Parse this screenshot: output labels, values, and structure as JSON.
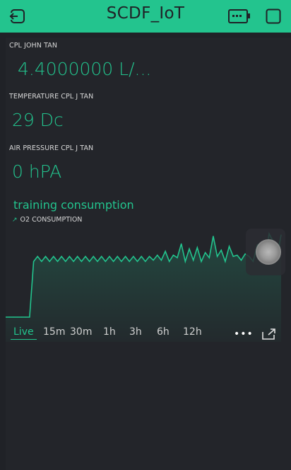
{
  "header": {
    "title": "SCDF_IoT",
    "left_icon": "exit-icon",
    "right_icons": [
      "device-icon",
      "square-icon"
    ]
  },
  "widgets": [
    {
      "label": "CPL JOHN TAN",
      "value": "4.4000000 L/..."
    },
    {
      "label": "TEMPERATURE CPL J TAN",
      "value": "29 Dc"
    },
    {
      "label": "AIR PRESSURE CPL J TAN",
      "value": "0 hPA"
    }
  ],
  "chart": {
    "title": "training consumption",
    "legend": "O2 CONSUMPTION",
    "tabs": [
      "Live",
      "15m",
      "30m",
      "1h",
      "3h",
      "6h",
      "12h"
    ],
    "active_tab": "Live",
    "more_label": "•••"
  },
  "colors": {
    "accent": "#23c48e",
    "background": "#202227",
    "panel": "#23252a"
  },
  "chart_data": {
    "type": "area",
    "series": [
      {
        "name": "O2 CONSUMPTION",
        "values": [
          0,
          0,
          0,
          0,
          0,
          0,
          0,
          88,
          96,
          88,
          96,
          88,
          96,
          88,
          96,
          88,
          96,
          88,
          96,
          88,
          96,
          88,
          96,
          88,
          96,
          88,
          96,
          88,
          96,
          88,
          96,
          88,
          96,
          88,
          96,
          88,
          96,
          90,
          98,
          90,
          104,
          88,
          98,
          94,
          116,
          88,
          108,
          90,
          110,
          88,
          102,
          94,
          128,
          96,
          106,
          88,
          112,
          96,
          98,
          90,
          100,
          96,
          88,
          114,
          118,
          92,
          132,
          120,
          98,
          130
        ]
      }
    ],
    "grid": false
  }
}
